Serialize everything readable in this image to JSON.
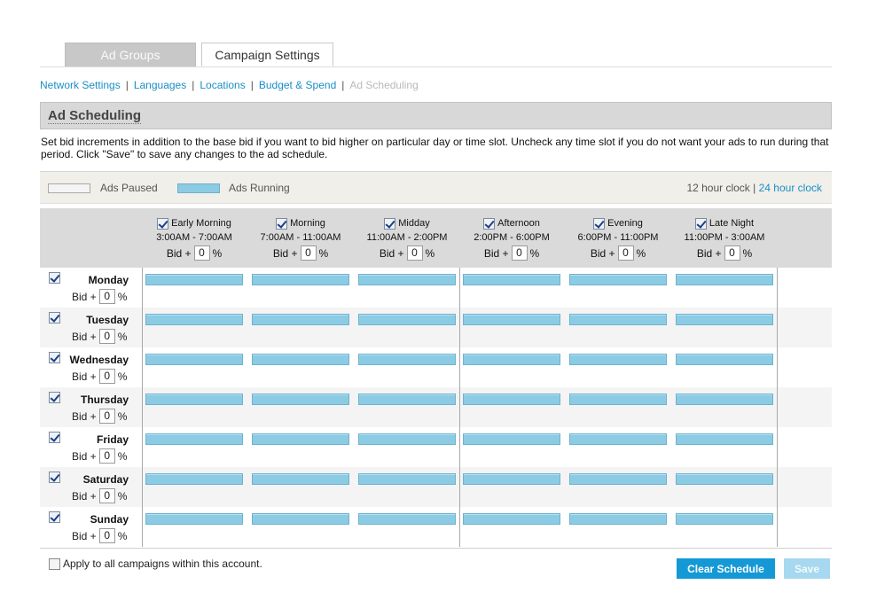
{
  "tabs": [
    {
      "label": "Ad Groups",
      "active": false
    },
    {
      "label": "Campaign Settings",
      "active": true
    }
  ],
  "subnav": [
    {
      "label": "Network Settings"
    },
    {
      "label": "Languages"
    },
    {
      "label": "Locations"
    },
    {
      "label": "Budget & Spend"
    },
    {
      "label": "Ad Scheduling"
    }
  ],
  "section": {
    "title": "Ad Scheduling",
    "description": "Set bid increments in addition to the base bid if you want to bid higher on particular day or time slot. Uncheck any time slot if you do not want your ads to run during that period. Click \"Save\" to save any changes to the ad schedule."
  },
  "legend": {
    "paused_label": "Ads Paused",
    "running_label": "Ads Running",
    "clock_12": "12 hour clock",
    "clock_sep": "|",
    "clock_24": "24 hour clock"
  },
  "bid_prefix": "Bid +",
  "bid_suffix": "%",
  "time_slots": [
    {
      "name": "Early Morning",
      "range": "3:00AM - 7:00AM",
      "bid": "0"
    },
    {
      "name": "Morning",
      "range": "7:00AM - 11:00AM",
      "bid": "0"
    },
    {
      "name": "Midday",
      "range": "11:00AM - 2:00PM",
      "bid": "0"
    },
    {
      "name": "Afternoon",
      "range": "2:00PM - 6:00PM",
      "bid": "0"
    },
    {
      "name": "Evening",
      "range": "6:00PM - 11:00PM",
      "bid": "0"
    },
    {
      "name": "Late Night",
      "range": "11:00PM - 3:00AM",
      "bid": "0"
    }
  ],
  "days": [
    {
      "name": "Monday",
      "bid": "0"
    },
    {
      "name": "Tuesday",
      "bid": "0"
    },
    {
      "name": "Wednesday",
      "bid": "0"
    },
    {
      "name": "Thursday",
      "bid": "0"
    },
    {
      "name": "Friday",
      "bid": "0"
    },
    {
      "name": "Saturday",
      "bid": "0"
    },
    {
      "name": "Sunday",
      "bid": "0"
    }
  ],
  "footer": {
    "apply_all_label": "Apply to all campaigns within this account.",
    "clear_label": "Clear Schedule",
    "save_label": "Save"
  },
  "colors": {
    "running": "#8ccbe4",
    "link": "#1a8ec6",
    "clear_button": "#1499d6",
    "save_button_disabled": "#a6d8ef"
  }
}
